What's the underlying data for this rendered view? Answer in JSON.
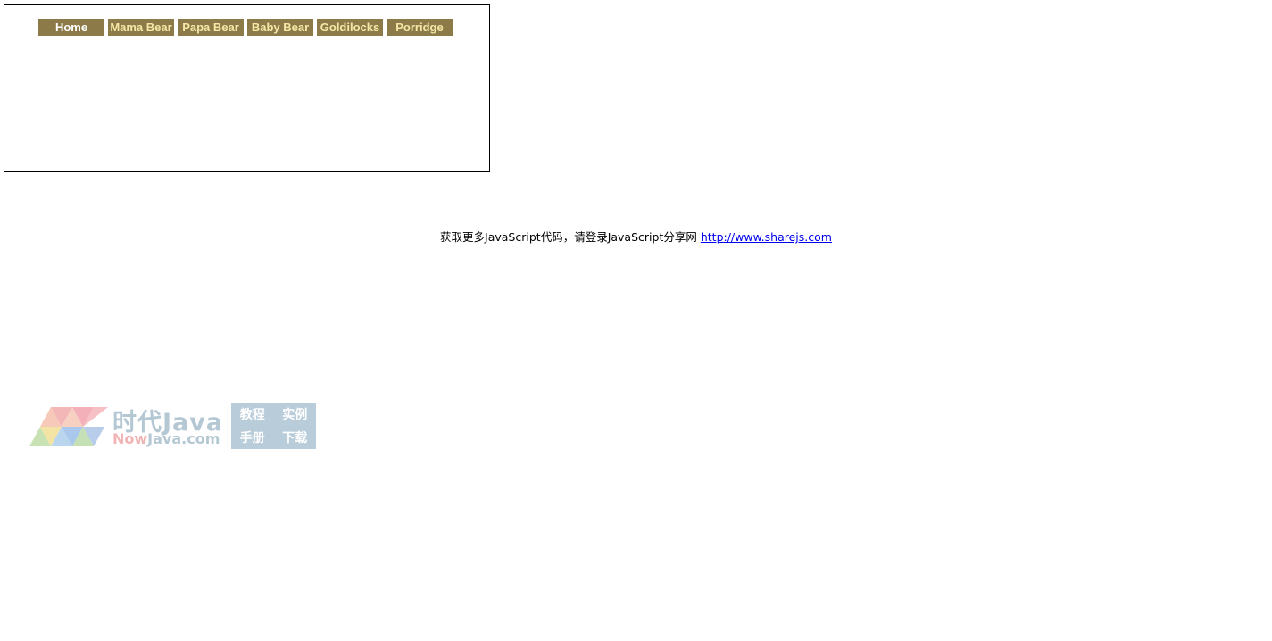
{
  "nav": {
    "items": [
      {
        "label": "Home",
        "text_color": "#ffffff"
      },
      {
        "label": "Mama Bear",
        "text_color": "#f5e8a6"
      },
      {
        "label": "Papa Bear",
        "text_color": "#f5e8a6"
      },
      {
        "label": "Baby Bear",
        "text_color": "#f5e8a6"
      },
      {
        "label": "Goldilocks",
        "text_color": "#f5e8a6"
      },
      {
        "label": "Porridge",
        "text_color": "#f5e8a6"
      }
    ],
    "background_color": "#8c7b48"
  },
  "footer": {
    "text": "获取更多JavaScript代码，请登录JavaScript分享网",
    "link_text": "http://www.sharejs.com"
  },
  "watermark": {
    "title_cn": "时代Java",
    "title_en_now": "Now",
    "title_en_rest": "Java.com",
    "badge": [
      "教程",
      "实例",
      "手册",
      "下载"
    ],
    "logo_icon": "triangle-mosaic-logo-icon"
  }
}
